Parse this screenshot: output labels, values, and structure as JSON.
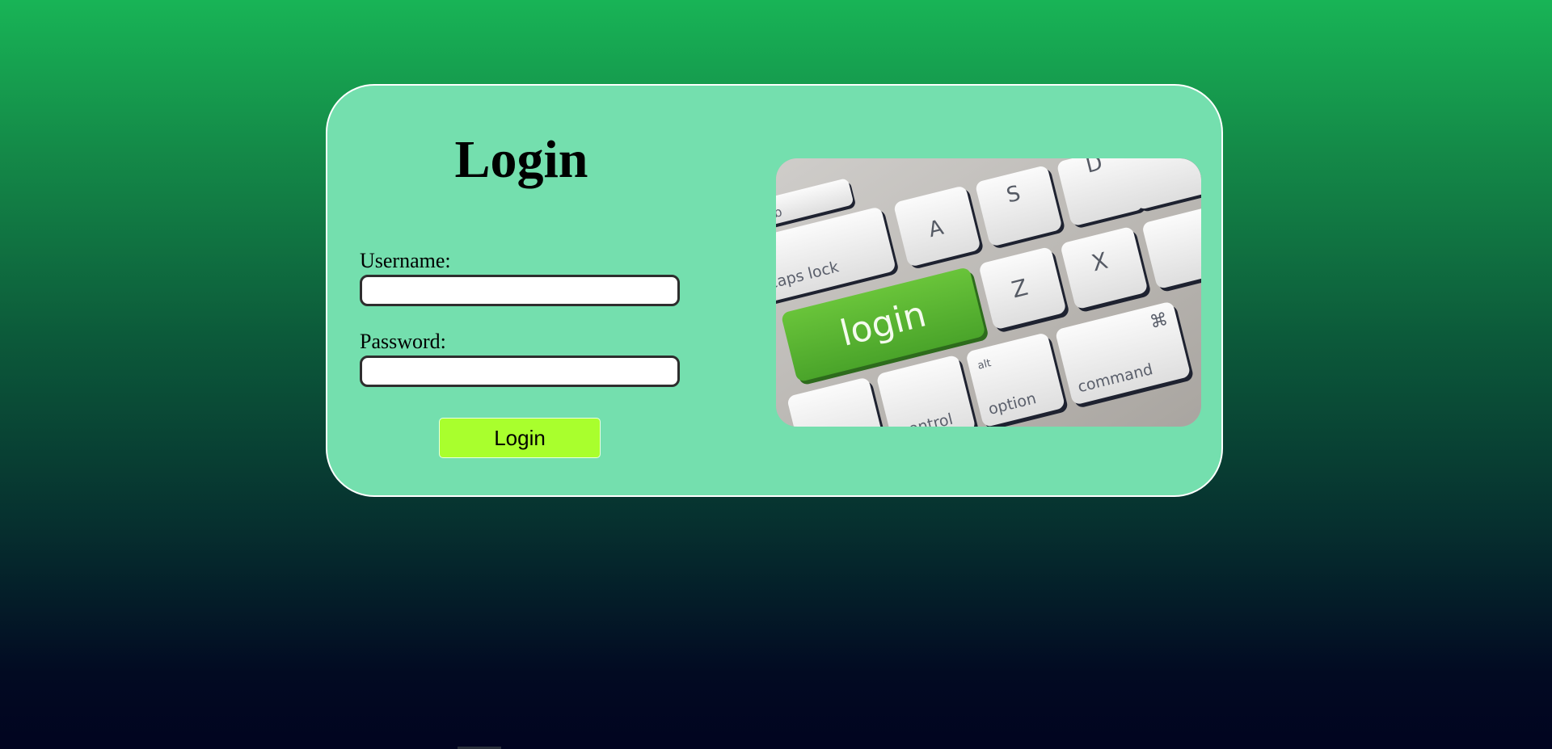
{
  "form": {
    "title": "Login",
    "username_label": "Username:",
    "username_value": "",
    "password_label": "Password:",
    "password_value": "",
    "submit_label": "Login"
  },
  "image": {
    "subject": "keyboard-login-key",
    "keys": {
      "tab": "Tab",
      "caps_lock": "caps lock",
      "login": "login",
      "a": "A",
      "s": "S",
      "d": "D",
      "z": "Z",
      "x": "X",
      "control": "control",
      "alt": "alt",
      "option": "option",
      "command": "command",
      "command_symbol": "⌘"
    }
  },
  "colors": {
    "card_background": "#74dfae",
    "button_background": "#a9ff2d",
    "login_key": "#5cb832"
  }
}
